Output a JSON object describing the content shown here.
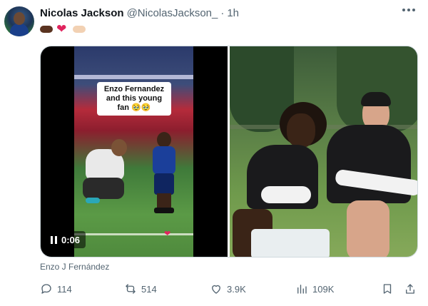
{
  "tweet": {
    "author": {
      "display_name": "Nicolas Jackson",
      "handle": "@NicolasJackson_",
      "separator": "·",
      "time": "1h"
    },
    "text_emojis": [
      "dark-fist",
      "red-heart",
      "light-fist"
    ],
    "media": {
      "video": {
        "caption": "Enzo Fernandez and this young fan 🥹🥹",
        "duration": "0:06",
        "state": "playing"
      },
      "credit": "Enzo J Fernández"
    },
    "actions": {
      "replies": "114",
      "retweets": "514",
      "likes": "3.9K",
      "views": "109K"
    }
  },
  "colors": {
    "text": "#0f1419",
    "muted": "#536471",
    "heart": "#e0245e",
    "border": "#cfd9de"
  }
}
